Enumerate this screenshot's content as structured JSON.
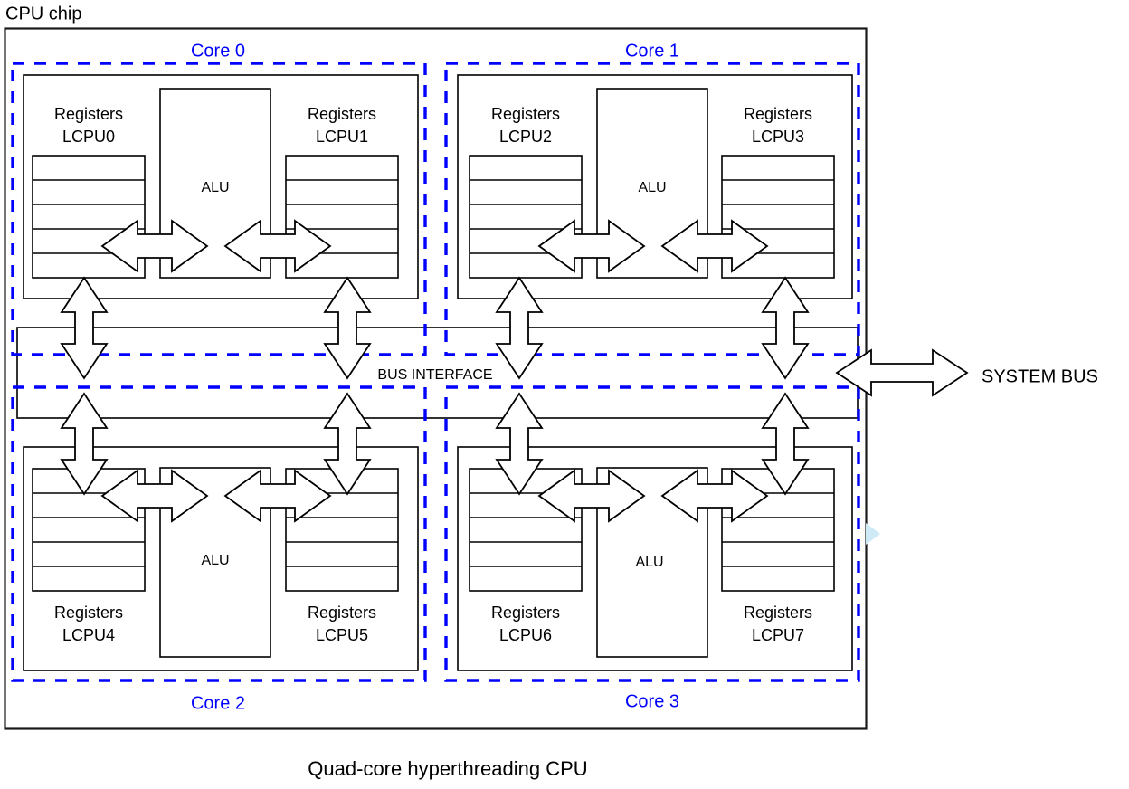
{
  "figure": {
    "chip_label": "CPU chip",
    "caption": "Quad-core hyperthreading CPU",
    "system_bus_label": "SYSTEM BUS",
    "bus_interface_label": "BUS INTERFACE",
    "colors": {
      "core_outline": "#0000ff",
      "core_label": "#0000ff",
      "box_outline": "#000000",
      "text": "#000000",
      "background": "#ffffff"
    }
  },
  "cores": [
    {
      "name": "Core 0",
      "label_position": "top",
      "alu_label": "ALU",
      "threads": [
        {
          "register_label_line1": "Registers",
          "register_label_line2": "LCPU0",
          "register_rows": 5,
          "label_position": "above"
        },
        {
          "register_label_line1": "Registers",
          "register_label_line2": "LCPU1",
          "register_rows": 5,
          "label_position": "above"
        }
      ]
    },
    {
      "name": "Core 1",
      "label_position": "top",
      "alu_label": "ALU",
      "threads": [
        {
          "register_label_line1": "Registers",
          "register_label_line2": "LCPU2",
          "register_rows": 5,
          "label_position": "above"
        },
        {
          "register_label_line1": "Registers",
          "register_label_line2": "LCPU3",
          "register_rows": 5,
          "label_position": "above"
        }
      ]
    },
    {
      "name": "Core 2",
      "label_position": "bottom",
      "alu_label": "ALU",
      "threads": [
        {
          "register_label_line1": "Registers",
          "register_label_line2": "LCPU4",
          "register_rows": 5,
          "label_position": "below"
        },
        {
          "register_label_line1": "Registers",
          "register_label_line2": "LCPU5",
          "register_rows": 5,
          "label_position": "below"
        }
      ]
    },
    {
      "name": "Core 3",
      "label_position": "bottom",
      "alu_label": "ALU",
      "threads": [
        {
          "register_label_line1": "Registers",
          "register_label_line2": "LCPU6",
          "register_rows": 5,
          "label_position": "below"
        },
        {
          "register_label_line1": "Registers",
          "register_label_line2": "LCPU7",
          "register_rows": 5,
          "label_position": "below"
        }
      ]
    }
  ],
  "labels": {
    "core_0": "Core 0",
    "core_1": "Core 1",
    "core_2": "Core 2",
    "core_3": "Core 3",
    "alu_c0": "ALU",
    "alu_c1": "ALU",
    "alu_c2": "ALU",
    "alu_c3": "ALU",
    "reg0_a": "Registers",
    "reg0_b": "LCPU0",
    "reg1_a": "Registers",
    "reg1_b": "LCPU1",
    "reg2_a": "Registers",
    "reg2_b": "LCPU2",
    "reg3_a": "Registers",
    "reg3_b": "LCPU3",
    "reg4_a": "Registers",
    "reg4_b": "LCPU4",
    "reg5_a": "Registers",
    "reg5_b": "LCPU5",
    "reg6_a": "Registers",
    "reg6_b": "LCPU6",
    "reg7_a": "Registers",
    "reg7_b": "LCPU7"
  },
  "connections": [
    {
      "from": "LCPU0 registers",
      "to": "Core 0 ALU",
      "kind": "bidirectional-horizontal"
    },
    {
      "from": "LCPU1 registers",
      "to": "Core 0 ALU",
      "kind": "bidirectional-horizontal"
    },
    {
      "from": "LCPU2 registers",
      "to": "Core 1 ALU",
      "kind": "bidirectional-horizontal"
    },
    {
      "from": "LCPU3 registers",
      "to": "Core 1 ALU",
      "kind": "bidirectional-horizontal"
    },
    {
      "from": "LCPU4 registers",
      "to": "Core 2 ALU",
      "kind": "bidirectional-horizontal"
    },
    {
      "from": "LCPU5 registers",
      "to": "Core 2 ALU",
      "kind": "bidirectional-horizontal"
    },
    {
      "from": "LCPU6 registers",
      "to": "Core 3 ALU",
      "kind": "bidirectional-horizontal"
    },
    {
      "from": "LCPU7 registers",
      "to": "Core 3 ALU",
      "kind": "bidirectional-horizontal"
    },
    {
      "from": "Core 0",
      "to": "BUS INTERFACE",
      "kind": "bidirectional-vertical"
    },
    {
      "from": "Core 1",
      "to": "BUS INTERFACE",
      "kind": "bidirectional-vertical"
    },
    {
      "from": "Core 2",
      "to": "BUS INTERFACE",
      "kind": "bidirectional-vertical"
    },
    {
      "from": "Core 3",
      "to": "BUS INTERFACE",
      "kind": "bidirectional-vertical"
    },
    {
      "from": "BUS INTERFACE",
      "to": "SYSTEM BUS",
      "kind": "bidirectional-horizontal"
    }
  ]
}
